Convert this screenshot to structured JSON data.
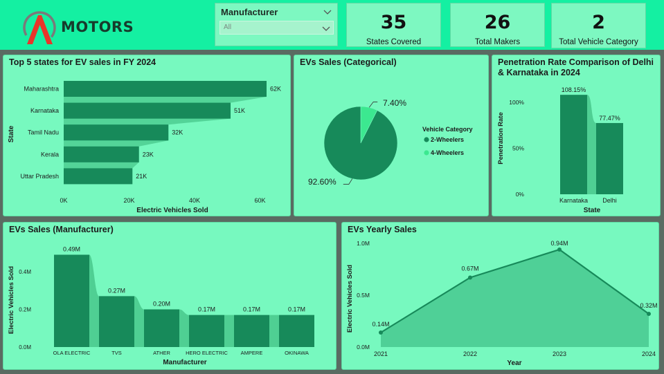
{
  "header": {
    "brand": "MOTORS",
    "slicer": {
      "title": "Manufacturer",
      "value": "All"
    },
    "kpis": [
      {
        "value": "35",
        "label": "States Covered"
      },
      {
        "value": "26",
        "label": "Total Makers"
      },
      {
        "value": "2",
        "label": "Total Vehicle Category"
      }
    ]
  },
  "colors": {
    "header": "#14f0a2",
    "panel": "#77f9bf",
    "bar": "#178a5a",
    "bar_shadow": "#4fcf93",
    "pie_light": "#3ce890"
  },
  "chart_data": [
    {
      "id": "top5",
      "type": "bar",
      "orientation": "horizontal",
      "title": "Top 5 states for EV sales in FY 2024",
      "categories": [
        "Maharashtra",
        "Karnataka",
        "Tamil Nadu",
        "Kerala",
        "Uttar Pradesh"
      ],
      "values": [
        62000,
        51000,
        32000,
        23000,
        21000
      ],
      "data_labels": [
        "62K",
        "51K",
        "32K",
        "23K",
        "21K"
      ],
      "xlabel": "Electric Vehicles Sold",
      "ylabel": "State",
      "xlim": [
        0,
        70000
      ],
      "x_ticks": [
        0,
        20000,
        40000,
        60000
      ],
      "x_tick_labels": [
        "0K",
        "20K",
        "40K",
        "60K"
      ]
    },
    {
      "id": "category",
      "type": "pie",
      "title": "EVs Sales (Categorical)",
      "legend_title": "Vehicle Category",
      "legend_position": "right",
      "slices": [
        {
          "label": "2-Wheelers",
          "value": 92.6,
          "display": "92.60%",
          "color": "#178a5a"
        },
        {
          "label": "4-Wheelers",
          "value": 7.4,
          "display": "7.40%",
          "color": "#3ce890"
        }
      ]
    },
    {
      "id": "penetration",
      "type": "bar",
      "title": "Penetration Rate Comparison of Delhi & Karnataka in 2024",
      "categories": [
        "Karnataka",
        "Delhi"
      ],
      "values": [
        108.15,
        77.47
      ],
      "data_labels": [
        "108.15%",
        "77.47%"
      ],
      "xlabel": "State",
      "ylabel": "Penetration Rate",
      "ylim": [
        0,
        120
      ],
      "y_ticks": [
        0,
        50,
        100
      ],
      "y_tick_labels": [
        "0%",
        "50%",
        "100%"
      ]
    },
    {
      "id": "manufacturer",
      "type": "bar",
      "title": "EVs Sales (Manufacturer)",
      "categories": [
        "OLA ELECTRIC",
        "TVS",
        "ATHER",
        "HERO ELECTRIC",
        "AMPERE",
        "OKINAWA"
      ],
      "values": [
        0.49,
        0.27,
        0.2,
        0.17,
        0.17,
        0.17
      ],
      "data_labels": [
        "0.49M",
        "0.27M",
        "0.20M",
        "0.17M",
        "0.17M",
        "0.17M"
      ],
      "xlabel": "Manufacturer",
      "ylabel": "Electric Vehicles Sold",
      "ylim": [
        0,
        0.5
      ],
      "y_ticks": [
        0,
        0.2,
        0.4
      ],
      "y_tick_labels": [
        "0.0M",
        "0.2M",
        "0.4M"
      ]
    },
    {
      "id": "yearly",
      "type": "area",
      "title": "EVs Yearly Sales",
      "x": [
        "2021",
        "2022",
        "2023",
        "2024"
      ],
      "values": [
        0.14,
        0.67,
        0.94,
        0.32
      ],
      "data_labels": [
        "0.14M",
        "0.67M",
        "0.94M",
        "0.32M"
      ],
      "xlabel": "Year",
      "ylabel": "Electric Vehicles Sold",
      "ylim": [
        0,
        1.0
      ],
      "y_ticks": [
        0,
        0.5,
        1.0
      ],
      "y_tick_labels": [
        "0.0M",
        "0.5M",
        "1.0M"
      ]
    }
  ]
}
